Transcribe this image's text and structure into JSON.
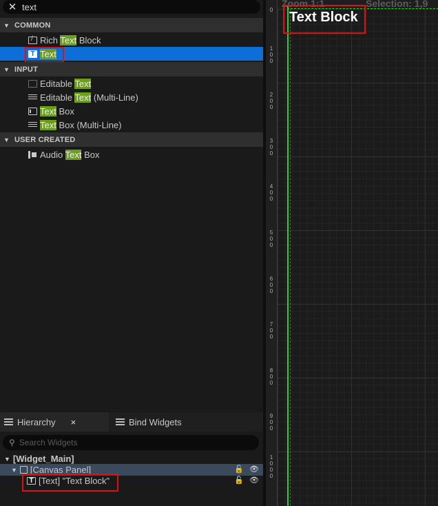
{
  "palette": {
    "search": {
      "value": "text"
    },
    "categories": [
      {
        "label": "COMMON"
      },
      {
        "label": "INPUT"
      },
      {
        "label": "USER CREATED"
      }
    ],
    "items": {
      "rich_text_block": {
        "pre": "Rich ",
        "hl": "Text",
        "post": " Block"
      },
      "text": {
        "pre": "",
        "hl": "Text",
        "post": ""
      },
      "editable_text": {
        "pre": "Editable ",
        "hl": "Text",
        "post": ""
      },
      "editable_text_multiline": {
        "pre": "Editable ",
        "hl": "Text",
        "post": " (Multi-Line)"
      },
      "text_box": {
        "pre": "",
        "hl": "Text",
        "post": " Box"
      },
      "text_box_multiline": {
        "pre": "",
        "hl": "Text",
        "post": " Box (Multi-Line)"
      },
      "audio_text_box": {
        "pre": "Audio ",
        "hl": "Text",
        "post": " Box"
      }
    },
    "icon_text_glyph": "T"
  },
  "bottom": {
    "tabs": {
      "hierarchy": "Hierarchy",
      "hierarchy_close": "×",
      "bind_widgets": "Bind Widgets"
    },
    "search_placeholder": "Search Widgets",
    "tree": {
      "root": "[Widget_Main]",
      "canvas": "[Canvas Panel]",
      "child": "[Text] \"Text Block\""
    }
  },
  "designer": {
    "top_left": "Zoom 1:1",
    "top_right": "Selection: 1,9",
    "text_block": "Text Block",
    "ruler": [
      "0",
      "1 0 0",
      "2 0 0",
      "3 0 0",
      "4 0 0",
      "5 0 0",
      "6 0 0",
      "7 0 0",
      "8 0 0",
      "9 0 0",
      "1 0 0 0"
    ]
  },
  "colors": {
    "selection": "#0d6ed8",
    "highlight": "#6b9e1e",
    "annotation": "#e01010",
    "guide": "#2ecc2e"
  }
}
